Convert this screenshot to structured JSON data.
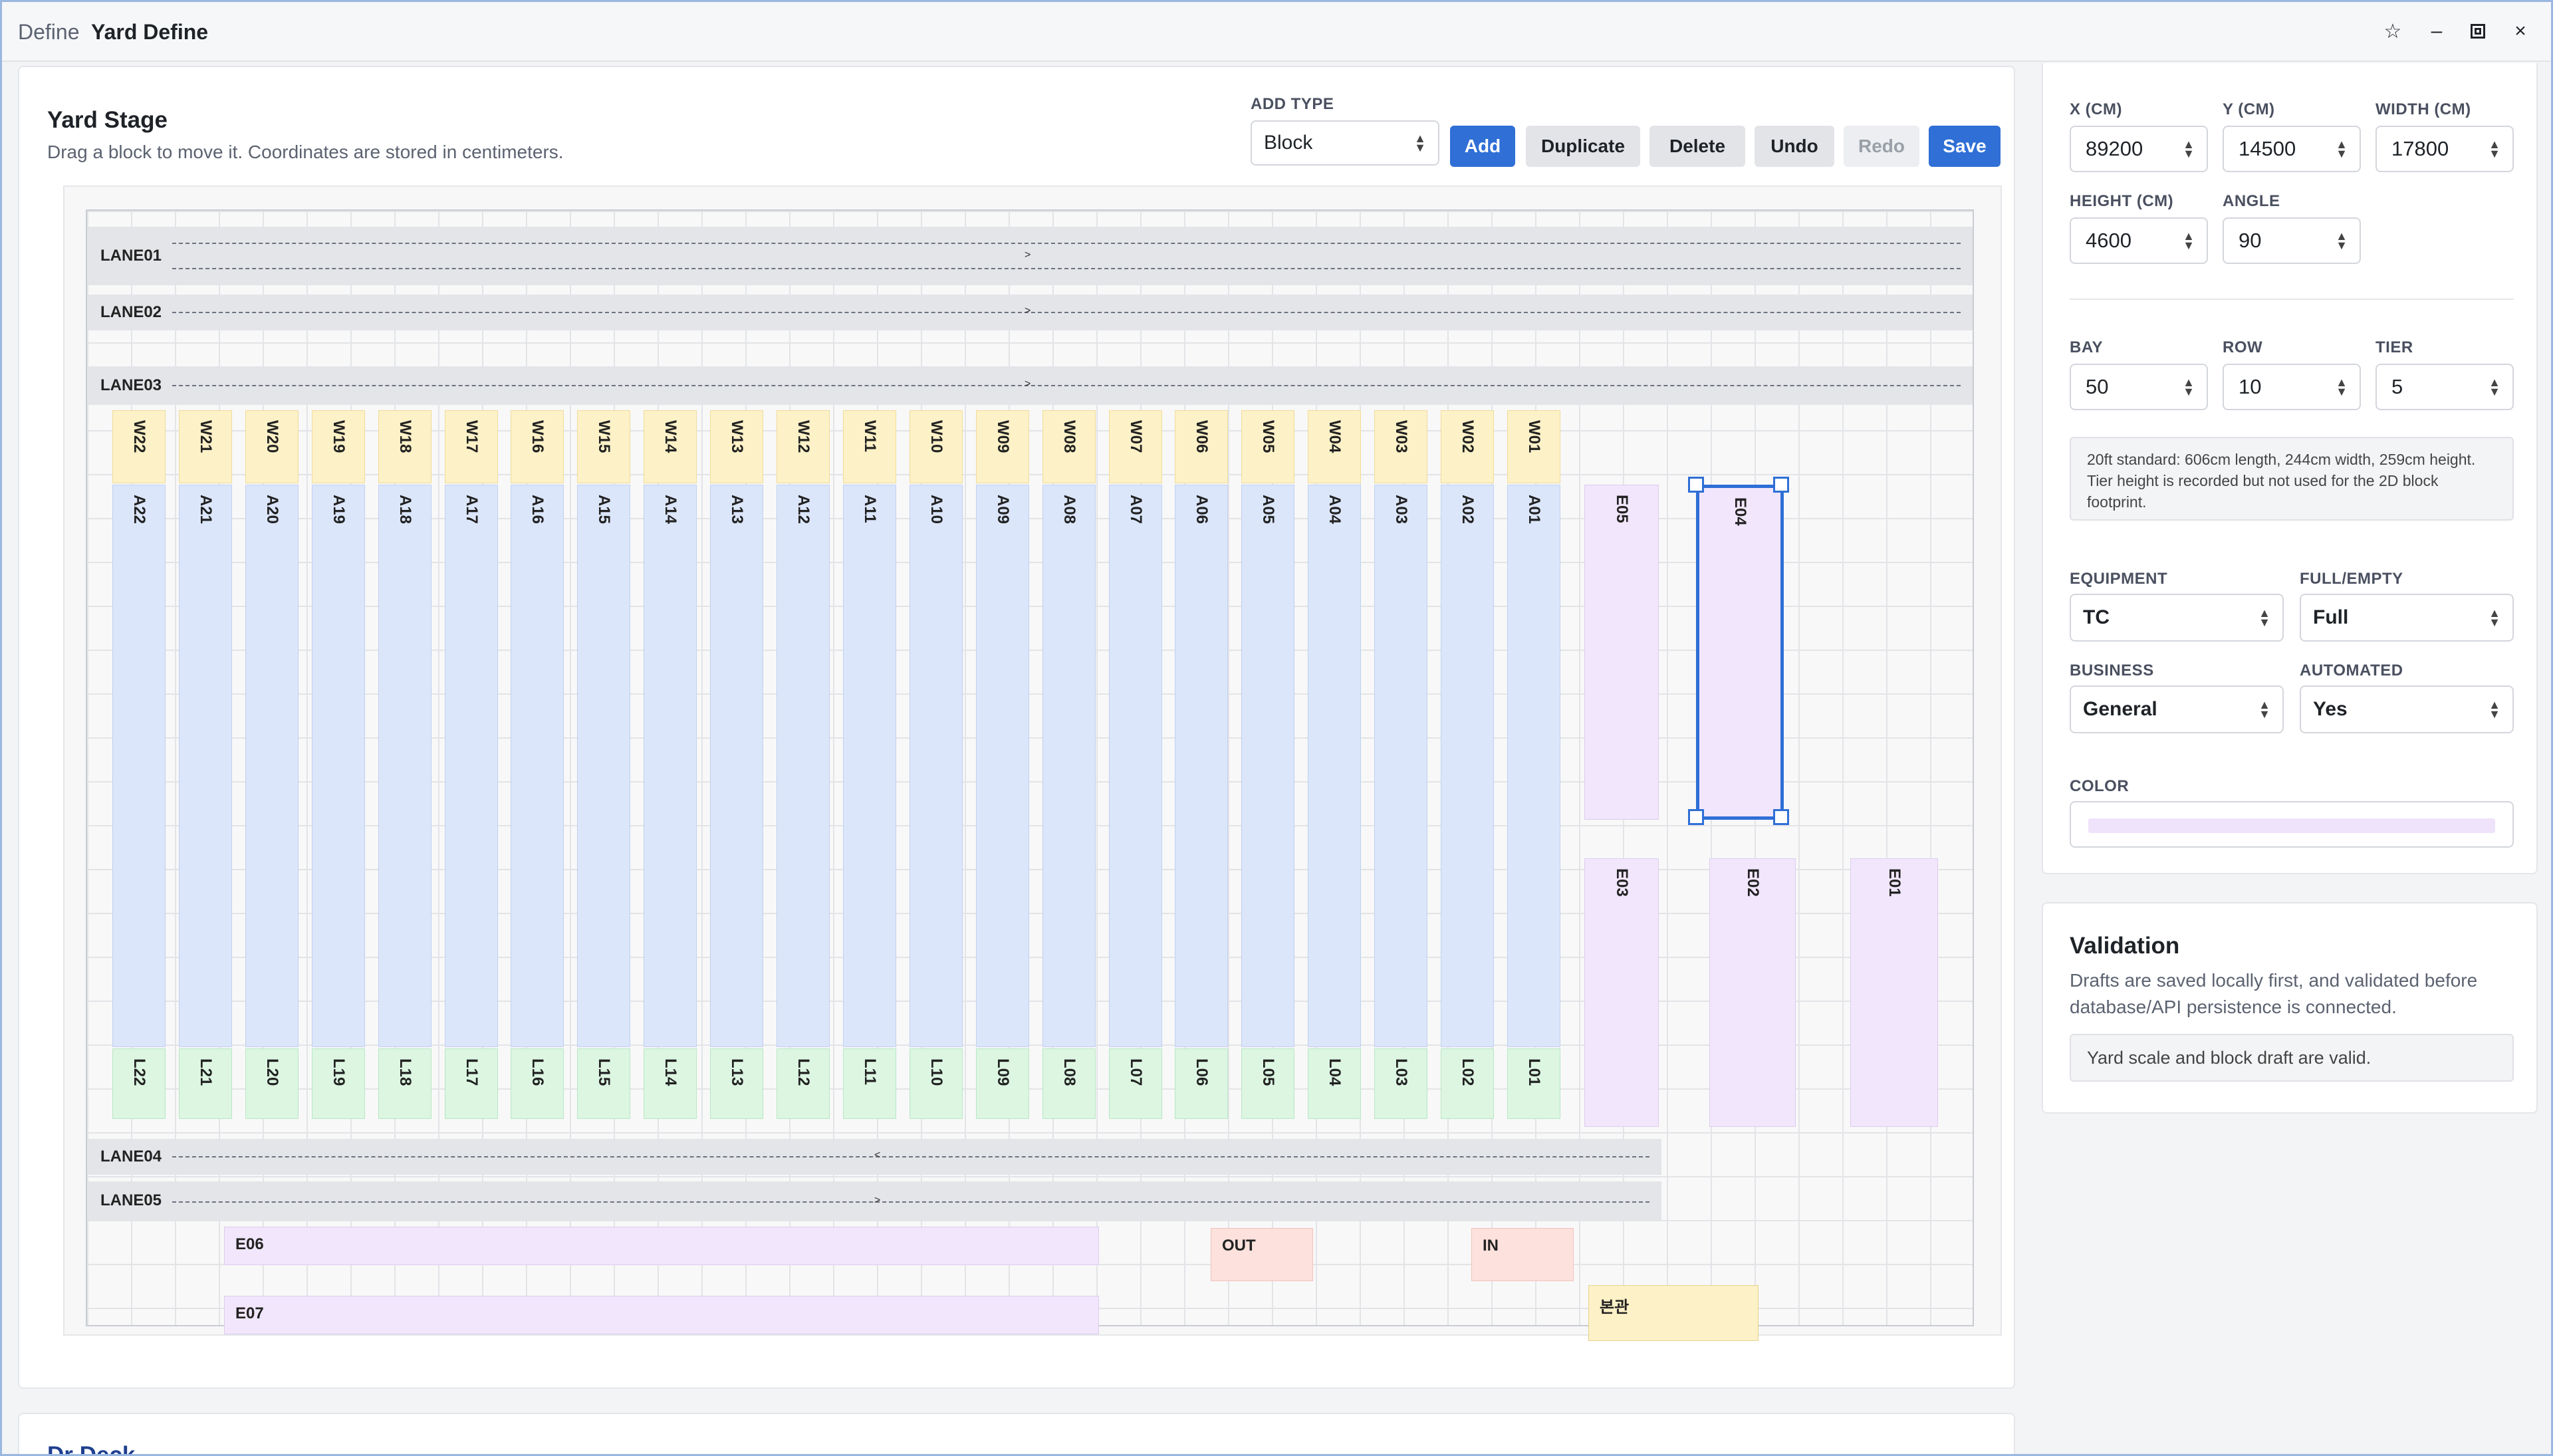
{
  "window": {
    "title_prefix": "Define",
    "title": "Yard Define"
  },
  "stage": {
    "title": "Yard Stage",
    "subtitle": "Drag a block to move it. Coordinates are stored in centimeters.",
    "add_type_label": "ADD TYPE",
    "add_type_value": "Block",
    "buttons": {
      "add": "Add",
      "duplicate": "Duplicate",
      "delete": "Delete",
      "undo": "Undo",
      "redo": "Redo",
      "save": "Save"
    },
    "lanes": [
      "LANE01",
      "LANE02",
      "LANE03",
      "LANE04",
      "LANE05"
    ],
    "w_blocks": [
      "W22",
      "W21",
      "W20",
      "W19",
      "W18",
      "W17",
      "W16",
      "W15",
      "W14",
      "W13",
      "W12",
      "W11",
      "W10",
      "W09",
      "W08",
      "W07",
      "W06",
      "W05",
      "W04",
      "W03",
      "W02",
      "W01"
    ],
    "a_blocks": [
      "A22",
      "A21",
      "A20",
      "A19",
      "A18",
      "A17",
      "A16",
      "A15",
      "A14",
      "A13",
      "A12",
      "A11",
      "A10",
      "A09",
      "A08",
      "A07",
      "A06",
      "A05",
      "A04",
      "A03",
      "A02",
      "A01"
    ],
    "l_blocks": [
      "L22",
      "L21",
      "L20",
      "L19",
      "L18",
      "L17",
      "L16",
      "L15",
      "L14",
      "L13",
      "L12",
      "L11",
      "L10",
      "L09",
      "L08",
      "L07",
      "L06",
      "L05",
      "L04",
      "L03",
      "L02",
      "L01"
    ],
    "e_blocks": {
      "e05": "E05",
      "e04": "E04",
      "e03": "E03",
      "e02": "E02",
      "e01": "E01",
      "e06": "E06",
      "e07": "E07"
    },
    "gates": {
      "out": "OUT",
      "in": "IN"
    },
    "main_building": "본관"
  },
  "props": {
    "x_label": "X (CM)",
    "x": "89200",
    "y_label": "Y (CM)",
    "y": "14500",
    "width_label": "WIDTH (CM)",
    "width": "17800",
    "height_label": "HEIGHT (CM)",
    "height": "4600",
    "angle_label": "ANGLE",
    "angle": "90",
    "bay_label": "BAY",
    "bay": "50",
    "row_label": "ROW",
    "row": "10",
    "tier_label": "TIER",
    "tier": "5",
    "note": "20ft standard: 606cm length, 244cm width, 259cm height. Tier height is recorded but not used for the 2D block footprint.",
    "equipment_label": "EQUIPMENT",
    "equipment": "TC",
    "full_empty_label": "FULL/EMPTY",
    "full_empty": "Full",
    "business_label": "BUSINESS",
    "business": "General",
    "automated_label": "AUTOMATED",
    "automated": "Yes",
    "color_label": "COLOR",
    "color_value": "#efe3fb"
  },
  "validation": {
    "title": "Validation",
    "description": "Drafts are saved locally first, and validated before database/API persistence is connected.",
    "status": "Yard scale and block draft are valid."
  },
  "lower_card": {
    "title": "Dr Deck"
  },
  "colors": {
    "accent": "#2f6fd6",
    "w_block": "#fdf1c7",
    "a_block": "#dbe6fb",
    "l_block": "#dcf6e2",
    "e_block": "#f1e6fb",
    "gate": "#fde1dd",
    "lane": "#e3e5e8"
  }
}
